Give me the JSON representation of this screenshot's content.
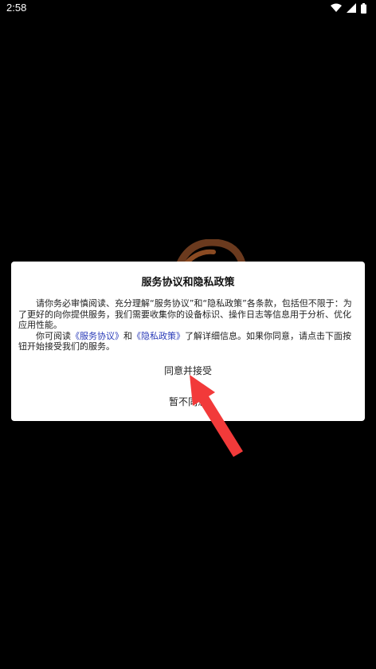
{
  "status_bar": {
    "time": "2:58"
  },
  "dialog": {
    "title": "服务协议和隐私政策",
    "paragraph1": "请你务必审慎阅读、充分理解“服务协议”和“隐私政策”各条款，包括但不限于：为了更好的向你提供服务，我们需要收集你的设备标识、操作日志等信息用于分析、优化应用性能。",
    "paragraph2_prefix": "你可阅读",
    "service_link": "《服务协议》",
    "paragraph2_mid": "和",
    "privacy_link": "《隐私政策》",
    "paragraph2_suffix": "了解详细信息。如果你同意，请点击下面按钮开始接受我们的服务。",
    "agree_label": "同意并接受",
    "disagree_label": "暂不同意"
  },
  "colors": {
    "background": "#000000",
    "dialog_background": "#ffffff",
    "link": "#2a3bb8",
    "annotation_arrow": "#f23a3a",
    "logo_brown": "#6b3a1e"
  },
  "icons": [
    "wifi-icon",
    "signal-icon",
    "battery-icon"
  ]
}
